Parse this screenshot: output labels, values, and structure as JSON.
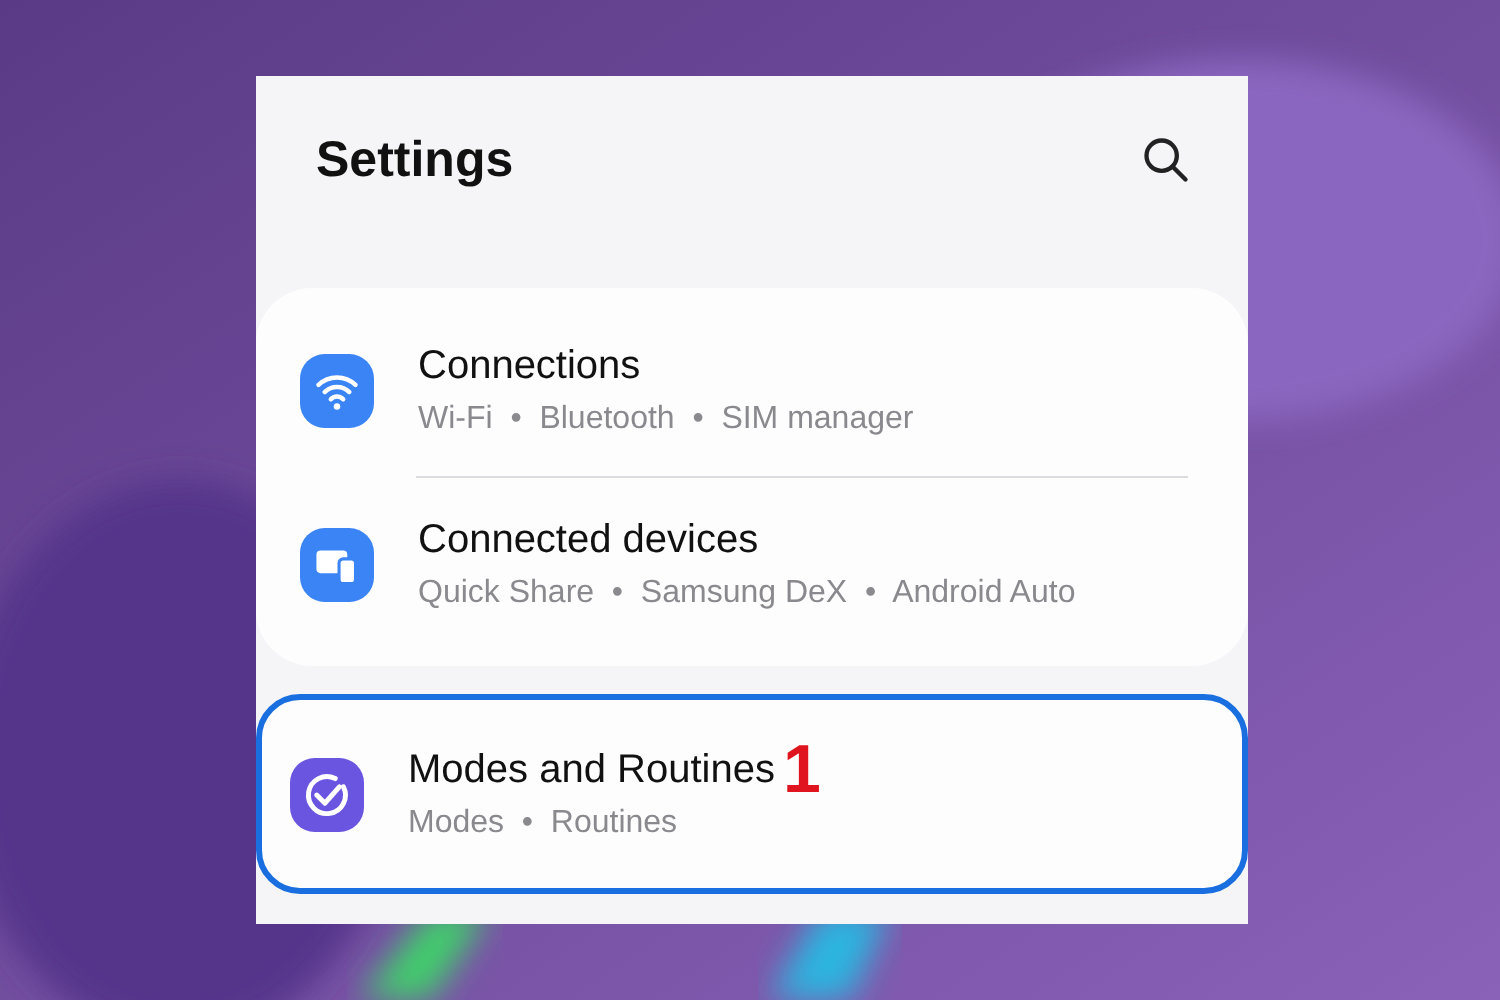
{
  "screen": {
    "title": "Settings"
  },
  "items": [
    {
      "title": "Connections",
      "subtitle": "Wi-Fi  •  Bluetooth  •  SIM manager",
      "highlighted": false
    },
    {
      "title": "Connected devices",
      "subtitle": "Quick Share  •  Samsung DeX  •  Android Auto",
      "highlighted": false
    },
    {
      "title": "Modes and Routines",
      "subtitle": "Modes  •  Routines",
      "highlighted": true,
      "annotation": "1"
    }
  ]
}
